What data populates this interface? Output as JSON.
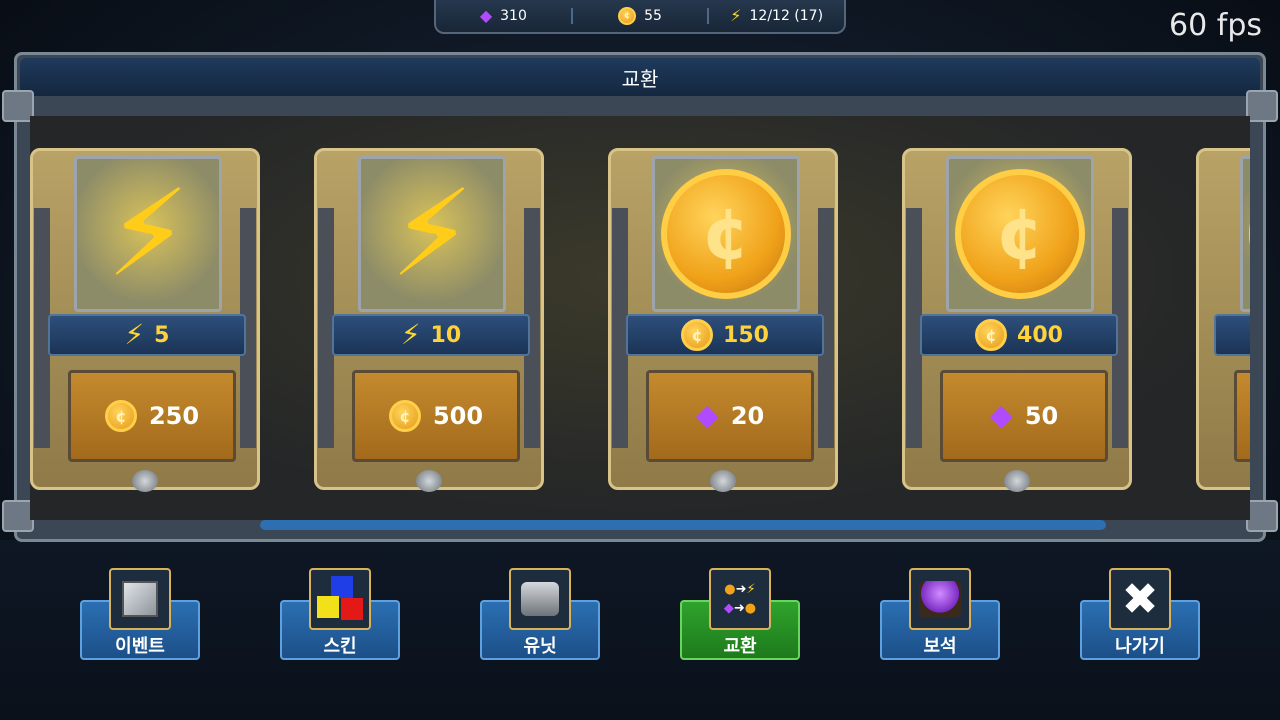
{
  "hud": {
    "gems": "310",
    "coins": "55",
    "energy": "12/12 (17)",
    "fps": "60 fps"
  },
  "panel": {
    "title": "교환"
  },
  "cards": [
    {
      "reward_type": "energy",
      "reward": "5",
      "cost_type": "coin",
      "cost": "250"
    },
    {
      "reward_type": "energy",
      "reward": "10",
      "cost_type": "coin",
      "cost": "500"
    },
    {
      "reward_type": "coin",
      "reward": "150",
      "cost_type": "gem",
      "cost": "20"
    },
    {
      "reward_type": "coin",
      "reward": "400",
      "cost_type": "gem",
      "cost": "50"
    }
  ],
  "nav": [
    {
      "label": "이벤트",
      "icon": "event-crate-icon",
      "active": false
    },
    {
      "label": "스킨",
      "icon": "skin-cubes-icon",
      "active": false
    },
    {
      "label": "유닛",
      "icon": "unit-robot-icon",
      "active": false
    },
    {
      "label": "교환",
      "icon": "exchange-icon",
      "active": true
    },
    {
      "label": "보석",
      "icon": "gem-cart-icon",
      "active": false
    },
    {
      "label": "나가기",
      "icon": "close-icon",
      "active": false
    }
  ],
  "colors": {
    "accent_blue": "#2b6fb2",
    "accent_green": "#2fa32d",
    "gold": "#ffd23a",
    "gem_purple": "#b04bff"
  }
}
